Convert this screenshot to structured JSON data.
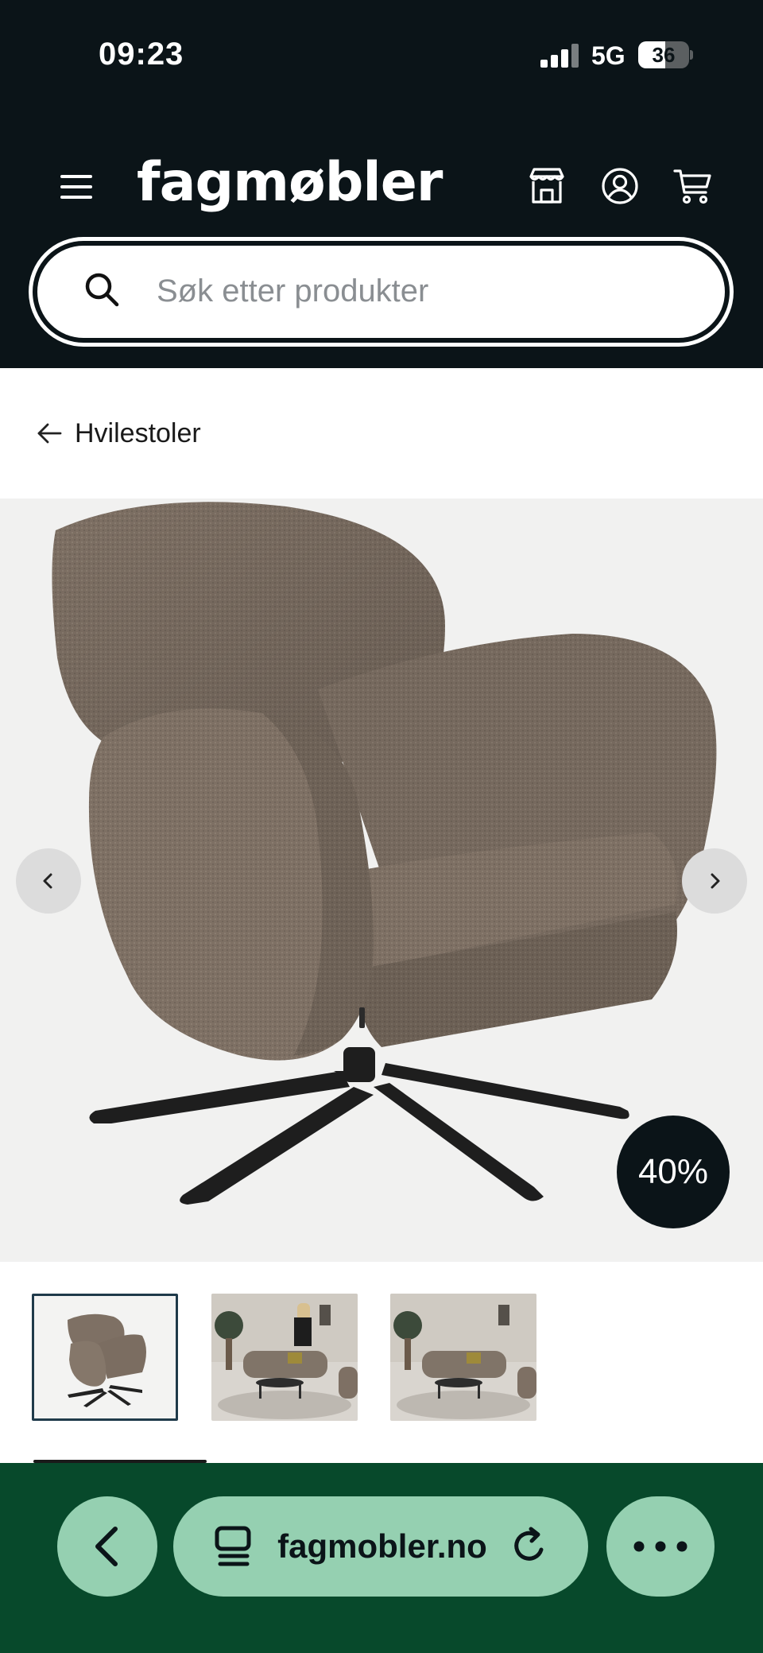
{
  "status_bar": {
    "time": "09:23",
    "network": "5G",
    "battery": "36"
  },
  "header": {
    "logo": "fagmøbler",
    "icons": [
      "menu-icon",
      "store-icon",
      "account-icon",
      "cart-icon"
    ]
  },
  "search": {
    "placeholder": "Søk etter produkter",
    "value": ""
  },
  "breadcrumb": {
    "label": "Hvilestoler"
  },
  "product": {
    "discount_badge": "40%",
    "thumbnails": [
      "chair-thumbnail",
      "living-room-thumbnail-1",
      "living-room-thumbnail-2"
    ],
    "active_thumbnail": 0
  },
  "browser": {
    "url": "fagmobler.no"
  },
  "colors": {
    "header_bg": "#0b1418",
    "browser_bar_bg": "#07492b",
    "browser_button": "#95d0b1",
    "image_bg": "#f1f1f0",
    "chair_fabric": "#7e7064"
  }
}
